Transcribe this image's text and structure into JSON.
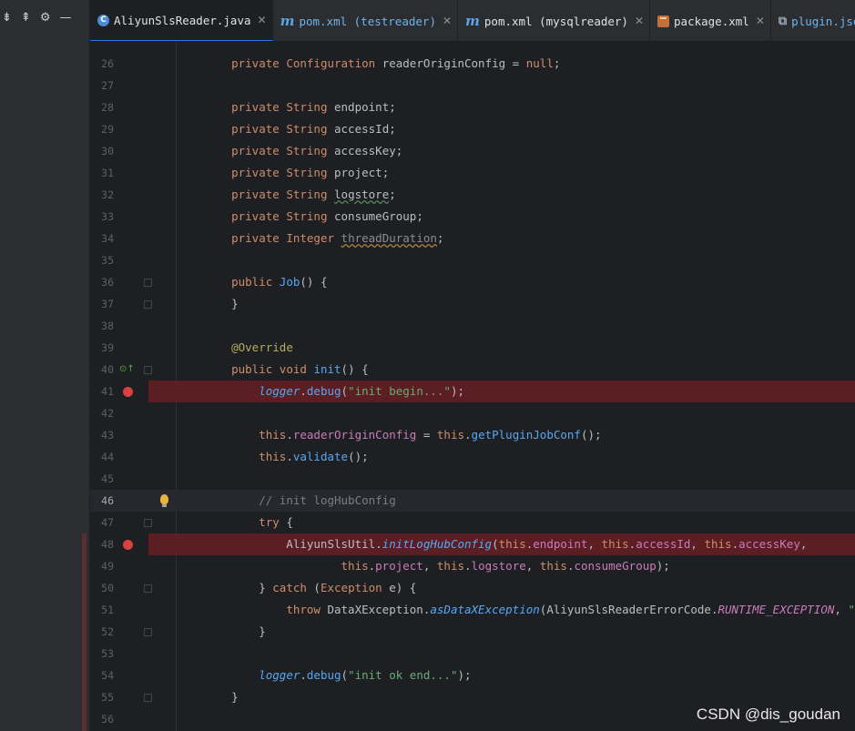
{
  "sidebar": {
    "toolbar": [
      {
        "name": "expand-all-icon",
        "glyph": "⇟"
      },
      {
        "name": "collapse-all-icon",
        "glyph": "⇞"
      },
      {
        "name": "settings-gear-icon",
        "glyph": "⚙"
      },
      {
        "name": "hide-panel-icon",
        "glyph": "—"
      }
    ]
  },
  "tabs": [
    {
      "label": "AliyunSlsReader.java",
      "icon": "java-class-icon",
      "active": true
    },
    {
      "label": "pom.xml (testreader)",
      "icon": "maven-m-icon",
      "active": false
    },
    {
      "label": "pom.xml (mysqlreader)",
      "icon": "maven-m-icon",
      "active": false
    },
    {
      "label": "package.xml",
      "icon": "package-xml-icon",
      "active": false
    },
    {
      "label": "plugin.json",
      "icon": "json-icon",
      "active": false
    }
  ],
  "editor": {
    "lines": [
      {
        "n": "",
        "text": ""
      },
      {
        "n": "26",
        "text": "    private Configuration readerOriginConfig = null;"
      },
      {
        "n": "27",
        "text": ""
      },
      {
        "n": "28",
        "text": "    private String endpoint;"
      },
      {
        "n": "29",
        "text": "    private String accessId;"
      },
      {
        "n": "30",
        "text": "    private String accessKey;"
      },
      {
        "n": "31",
        "text": "    private String project;"
      },
      {
        "n": "32",
        "text": "    private String logstore;"
      },
      {
        "n": "33",
        "text": "    private String consumeGroup;"
      },
      {
        "n": "34",
        "text": "    private Integer threadDuration;"
      },
      {
        "n": "35",
        "text": ""
      },
      {
        "n": "36",
        "text": "    public Job() {"
      },
      {
        "n": "37",
        "text": "    }"
      },
      {
        "n": "38",
        "text": ""
      },
      {
        "n": "39",
        "text": "    @Override"
      },
      {
        "n": "40",
        "text": "    public void init() {"
      },
      {
        "n": "41",
        "text": "        logger.debug(\"init begin...\");"
      },
      {
        "n": "42",
        "text": ""
      },
      {
        "n": "43",
        "text": "        this.readerOriginConfig = this.getPluginJobConf();"
      },
      {
        "n": "44",
        "text": "        this.validate();"
      },
      {
        "n": "45",
        "text": ""
      },
      {
        "n": "46",
        "text": "        // init logHubConfig"
      },
      {
        "n": "47",
        "text": "        try {"
      },
      {
        "n": "48",
        "text": "            AliyunSlsUtil.initLogHubConfig(this.endpoint, this.accessId, this.accessKey,"
      },
      {
        "n": "49",
        "text": "                    this.project, this.logstore, this.consumeGroup);"
      },
      {
        "n": "50",
        "text": "        } catch (Exception e) {"
      },
      {
        "n": "51",
        "text": "            throw DataXException.asDataXException(AliyunSlsReaderErrorCode.RUNTIME_EXCEPTION, \"阿里云SLS服务"
      },
      {
        "n": "52",
        "text": "        }"
      },
      {
        "n": "53",
        "text": ""
      },
      {
        "n": "54",
        "text": "        logger.debug(\"init ok end...\");"
      },
      {
        "n": "55",
        "text": "    }"
      },
      {
        "n": "56",
        "text": ""
      }
    ],
    "breakpoint_lines": [
      "41",
      "48"
    ],
    "current_line": "46"
  },
  "watermark": "CSDN @dis_goudan"
}
